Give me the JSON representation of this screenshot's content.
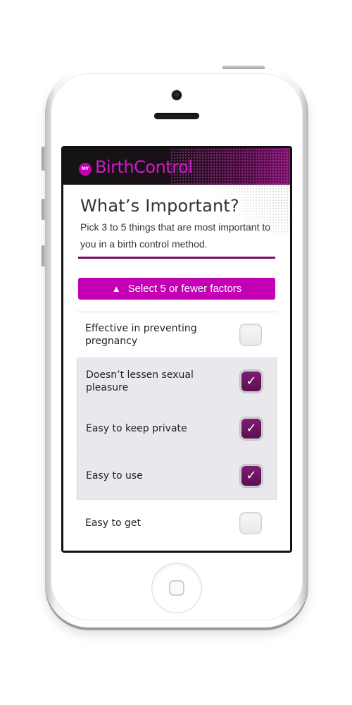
{
  "app": {
    "logo_badge": "MY",
    "logo_text": "BirthControl"
  },
  "page": {
    "title": "What’s Important?",
    "subtitle": "Pick 3 to 5 things that are most important to you in a birth control method."
  },
  "banner": {
    "icon": "warning-icon",
    "text": "Select 5 or fewer factors",
    "color": "#c400b5"
  },
  "factors": [
    {
      "label": "Effective in preventing pregnancy",
      "checked": false
    },
    {
      "label": "Doesn’t lessen sexual pleasure",
      "checked": true
    },
    {
      "label": "Easy to keep private",
      "checked": true
    },
    {
      "label": "Easy to use",
      "checked": true
    },
    {
      "label": "Easy to get",
      "checked": false
    }
  ],
  "colors": {
    "accent": "#c400b5",
    "rule": "#7a0c6d",
    "checkbox_on": "#6b1562"
  }
}
